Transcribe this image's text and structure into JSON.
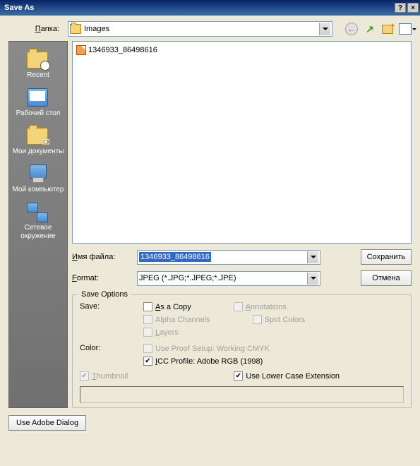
{
  "window": {
    "title": "Save As"
  },
  "folder": {
    "label": "Папка:",
    "value": "Images"
  },
  "places": [
    {
      "label": "Recent",
      "icon": "folder-clock"
    },
    {
      "label": "Рабочий стол",
      "icon": "desktop"
    },
    {
      "label": "Мои документы",
      "icon": "folder-docs"
    },
    {
      "label": "Мой компьютер",
      "icon": "computer"
    },
    {
      "label": "Сетевое окружение",
      "icon": "network"
    }
  ],
  "file_list": [
    {
      "name": "1346933_86498616"
    }
  ],
  "filename": {
    "label": "Имя файла:",
    "value": "1346933_86498616"
  },
  "format": {
    "label": "Format:",
    "value": "JPEG (*.JPG;*.JPEG;*.JPE)"
  },
  "buttons": {
    "save": "Сохранить",
    "cancel": "Отмена",
    "adobe_dialog": "Use Adobe Dialog"
  },
  "save_options": {
    "legend": "Save Options",
    "save_label": "Save:",
    "as_a_copy": {
      "label": "As a Copy",
      "checked": false,
      "enabled": true
    },
    "annotations": {
      "label": "Annotations",
      "checked": false,
      "enabled": false
    },
    "alpha_channels": {
      "label": "Alpha Channels",
      "checked": false,
      "enabled": false
    },
    "spot_colors": {
      "label": "Spot Colors",
      "checked": false,
      "enabled": false
    },
    "layers": {
      "label": "Layers",
      "checked": false,
      "enabled": false
    },
    "color_label": "Color:",
    "proof_setup": {
      "label": "Use Proof Setup:  Working CMYK",
      "checked": false,
      "enabled": false
    },
    "icc_profile": {
      "label": "ICC Profile:  Adobe RGB (1998)",
      "checked": true,
      "enabled": true
    },
    "thumbnail": {
      "label": "Thumbnail",
      "checked": true,
      "enabled": false
    },
    "lowercase": {
      "label": "Use Lower Case Extension",
      "checked": true,
      "enabled": true
    }
  }
}
